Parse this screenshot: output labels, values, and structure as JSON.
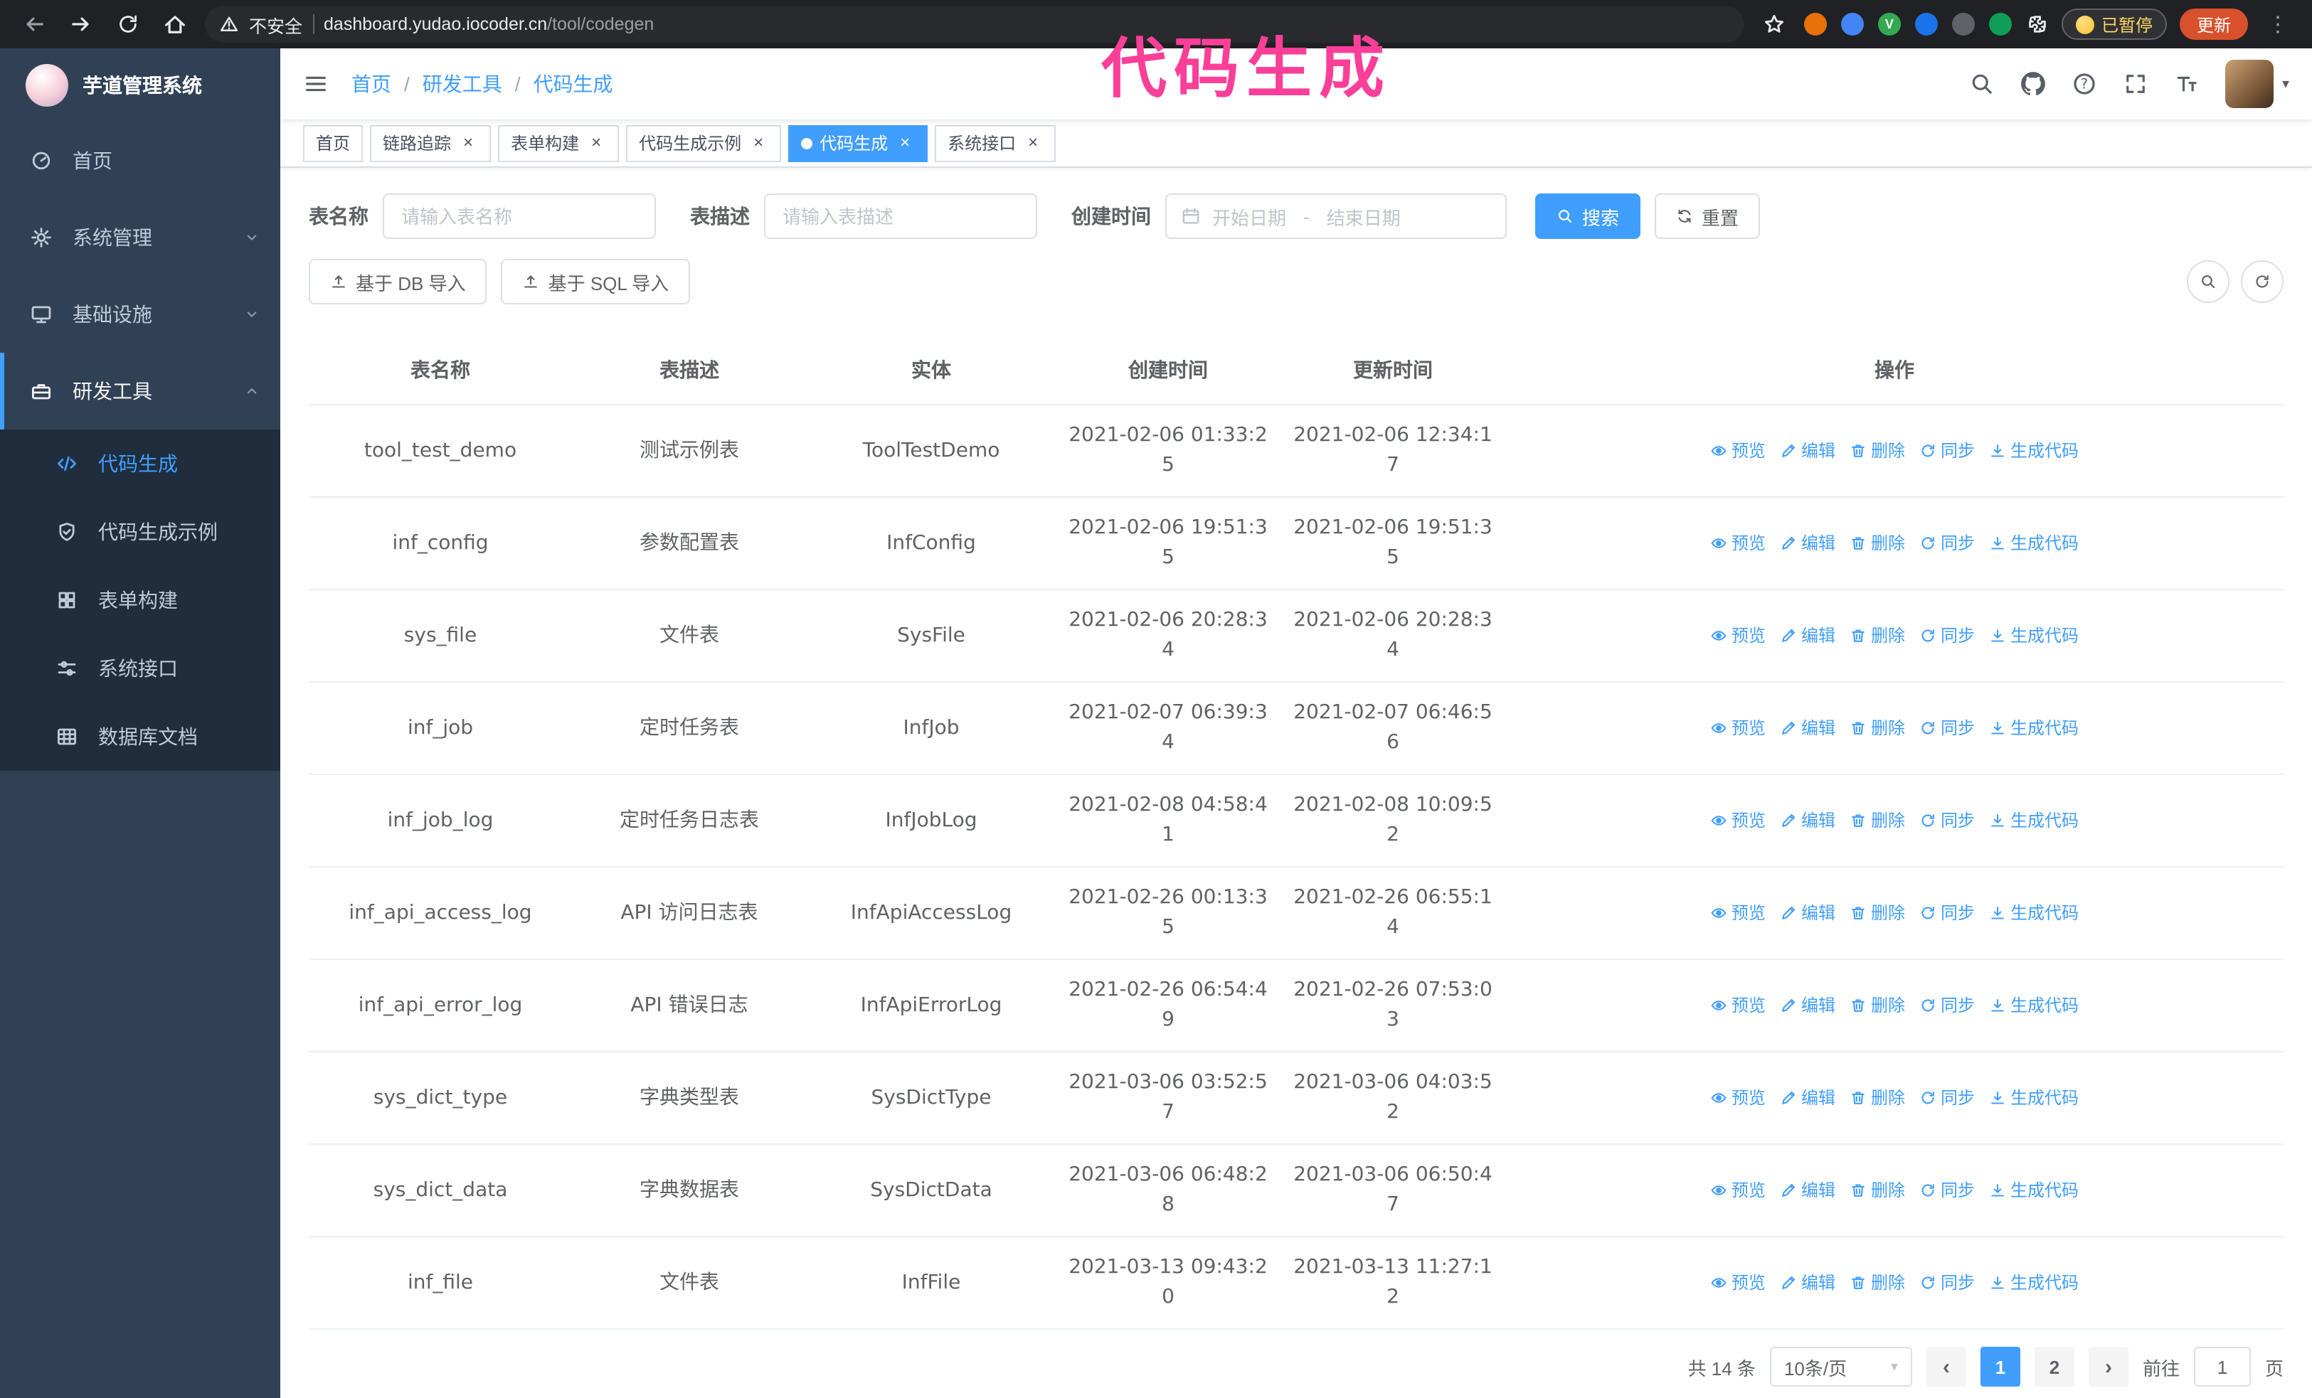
{
  "browser": {
    "security_warning": "不安全",
    "url_host": "dashboard.yudao.iocoder.cn",
    "url_path": "/tool/codegen",
    "paused_badge": "已暂停",
    "update_button": "更新"
  },
  "annotation": {
    "text": "代码生成"
  },
  "icons": {
    "close": "×",
    "caret_down": "▾",
    "prev": "‹",
    "next": "›",
    "menu_dots": "⋮",
    "slash": "/",
    "question": "?",
    "ext_v_badge": "V"
  },
  "sidebar": {
    "logo_title": "芋道管理系统",
    "items": [
      {
        "label": "首页"
      },
      {
        "label": "系统管理"
      },
      {
        "label": "基础设施"
      },
      {
        "label": "研发工具"
      }
    ],
    "sub_items": [
      {
        "label": "代码生成"
      },
      {
        "label": "代码生成示例"
      },
      {
        "label": "表单构建"
      },
      {
        "label": "系统接口"
      },
      {
        "label": "数据库文档"
      }
    ]
  },
  "navbar": {
    "breadcrumb": [
      "首页",
      "研发工具",
      "代码生成"
    ]
  },
  "tabs": [
    {
      "label": "首页"
    },
    {
      "label": "链路追踪"
    },
    {
      "label": "表单构建"
    },
    {
      "label": "代码生成示例"
    },
    {
      "label": "代码生成"
    },
    {
      "label": "系统接口"
    }
  ],
  "search_form": {
    "table_name_label": "表名称",
    "table_name_placeholder": "请输入表名称",
    "table_desc_label": "表描述",
    "table_desc_placeholder": "请输入表描述",
    "create_time_label": "创建时间",
    "date_start_placeholder": "开始日期",
    "date_separator": "-",
    "date_end_placeholder": "结束日期",
    "search_button": "搜索",
    "reset_button": "重置"
  },
  "toolbar": {
    "import_db_button": "基于 DB 导入",
    "import_sql_button": "基于 SQL 导入"
  },
  "table": {
    "headers": [
      "表名称",
      "表描述",
      "实体",
      "创建时间",
      "更新时间",
      "操作"
    ],
    "actions": [
      "预览",
      "编辑",
      "删除",
      "同步",
      "生成代码"
    ],
    "rows": [
      {
        "name": "tool_test_demo",
        "desc": "测试示例表",
        "entity": "ToolTestDemo",
        "created": "2021-02-06 01:33:25",
        "updated": "2021-02-06 12:34:17"
      },
      {
        "name": "inf_config",
        "desc": "参数配置表",
        "entity": "InfConfig",
        "created": "2021-02-06 19:51:35",
        "updated": "2021-02-06 19:51:35"
      },
      {
        "name": "sys_file",
        "desc": "文件表",
        "entity": "SysFile",
        "created": "2021-02-06 20:28:34",
        "updated": "2021-02-06 20:28:34"
      },
      {
        "name": "inf_job",
        "desc": "定时任务表",
        "entity": "InfJob",
        "created": "2021-02-07 06:39:34",
        "updated": "2021-02-07 06:46:56"
      },
      {
        "name": "inf_job_log",
        "desc": "定时任务日志表",
        "entity": "InfJobLog",
        "created": "2021-02-08 04:58:41",
        "updated": "2021-02-08 10:09:52"
      },
      {
        "name": "inf_api_access_log",
        "desc": "API 访问日志表",
        "entity": "InfApiAccessLog",
        "created": "2021-02-26 00:13:35",
        "updated": "2021-02-26 06:55:14"
      },
      {
        "name": "inf_api_error_log",
        "desc": "API 错误日志",
        "entity": "InfApiErrorLog",
        "created": "2021-02-26 06:54:49",
        "updated": "2021-02-26 07:53:03"
      },
      {
        "name": "sys_dict_type",
        "desc": "字典类型表",
        "entity": "SysDictType",
        "created": "2021-03-06 03:52:57",
        "updated": "2021-03-06 04:03:52"
      },
      {
        "name": "sys_dict_data",
        "desc": "字典数据表",
        "entity": "SysDictData",
        "created": "2021-03-06 06:48:28",
        "updated": "2021-03-06 06:50:47"
      },
      {
        "name": "inf_file",
        "desc": "文件表",
        "entity": "InfFile",
        "created": "2021-03-13 09:43:20",
        "updated": "2021-03-13 11:27:12"
      }
    ]
  },
  "pagination": {
    "total_label": "共 14 条",
    "page_size_label": "10条/页",
    "pages": [
      "1",
      "2"
    ],
    "active_page": "1",
    "goto_label": "前往",
    "goto_value": "1",
    "goto_unit": "页"
  }
}
